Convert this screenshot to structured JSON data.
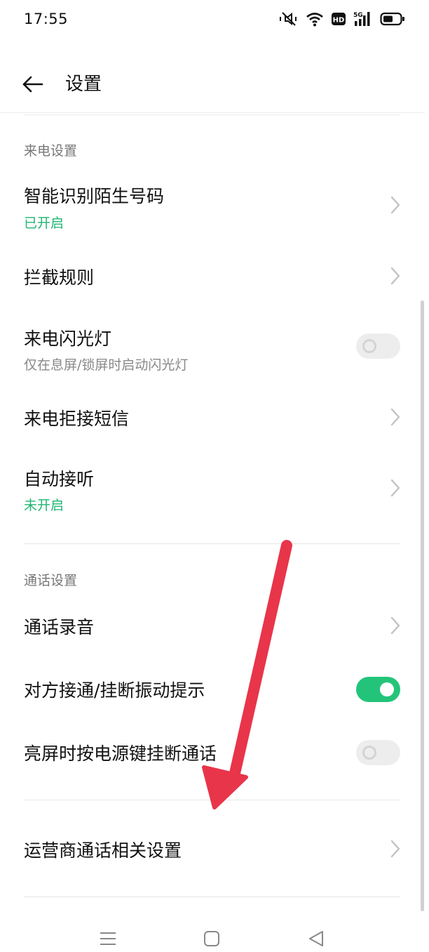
{
  "status_bar": {
    "time": "17:55",
    "icons": [
      "mute-icon",
      "wifi-icon",
      "hd-icon",
      "signal-5g-icon",
      "battery-icon"
    ],
    "hd_label": "HD",
    "network_label": "5G"
  },
  "header": {
    "back_icon": "arrow-left-icon",
    "title": "设置"
  },
  "sections": {
    "incoming": {
      "title": "来电设置",
      "items": [
        {
          "title": "智能识别陌生号码",
          "subtitle": "已开启",
          "control": "chevron"
        },
        {
          "title": "拦截规则",
          "control": "chevron"
        },
        {
          "title": "来电闪光灯",
          "subtitle": "仅在息屏/锁屏时启动闪光灯",
          "control": "toggle",
          "toggle_state": "off"
        },
        {
          "title": "来电拒接短信",
          "control": "chevron"
        },
        {
          "title": "自动接听",
          "subtitle": "未开启",
          "control": "chevron"
        }
      ]
    },
    "call": {
      "title": "通话设置",
      "items": [
        {
          "title": "通话录音",
          "control": "chevron"
        },
        {
          "title": "对方接通/挂断振动提示",
          "control": "toggle",
          "toggle_state": "on"
        },
        {
          "title": "亮屏时按电源键挂断通话",
          "control": "toggle",
          "toggle_state": "off"
        }
      ]
    },
    "carrier": {
      "items": [
        {
          "title": "运营商通话相关设置",
          "control": "chevron"
        }
      ]
    }
  },
  "nav_bar": {
    "icons": [
      "menu-icon",
      "home-icon",
      "back-triangle-icon"
    ]
  },
  "colors": {
    "accent_green": "#23c47a",
    "status_green_text": "#20b573",
    "annotation_arrow": "#e8354a"
  }
}
